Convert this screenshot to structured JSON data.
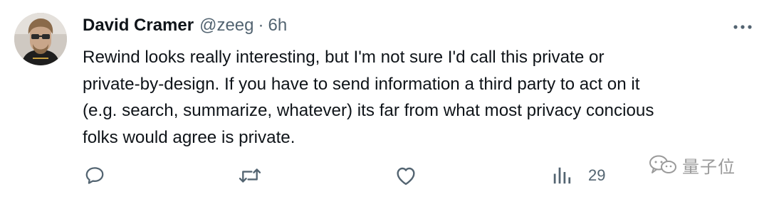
{
  "author": {
    "name": "David Cramer",
    "handle": "@zeeg",
    "separator": "·",
    "time": "6h"
  },
  "tweet": {
    "text": "Rewind looks really interesting, but I'm not sure I'd call this private or\nprivate-by-design. If you have to send information a third party to act on it\n(e.g. search, summarize, whatever) its far from what most privacy concious\nfolks would agree is private."
  },
  "actions": {
    "reply_icon": "reply-icon",
    "retweet_icon": "retweet-icon",
    "like_icon": "heart-icon",
    "views_icon": "analytics-icon",
    "views_count": "29",
    "share_icon": "share-icon"
  },
  "watermark": {
    "text": "量子位"
  },
  "colors": {
    "text_primary": "#0f1419",
    "text_secondary": "#536471",
    "background": "#ffffff"
  }
}
